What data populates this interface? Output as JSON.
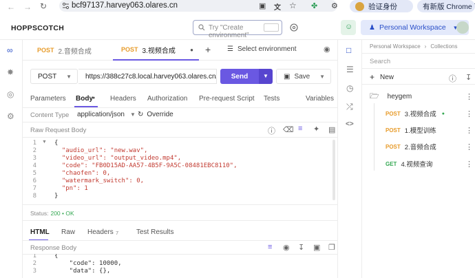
{
  "browser": {
    "url": "bcf97137.harvey063.olares.cn",
    "profile_label": "验证身份",
    "update_label": "有新版 Chrome 可用"
  },
  "header": {
    "brand": "HOPPSCOTCH",
    "search_placeholder": "Try \"Create environment\"",
    "workspace_label": "Personal Workspace"
  },
  "tabs": [
    {
      "method": "POST",
      "label": "2.音频合成"
    },
    {
      "method": "POST",
      "label": "3.视频合成"
    }
  ],
  "env_select": "Select environment",
  "request": {
    "method": "POST",
    "url": "https://388c27c8.local.harvey063.olares.cn/easy",
    "send_label": "Send",
    "save_label": "Save"
  },
  "request_tabs": [
    "Parameters",
    "Body",
    "Headers",
    "Authorization",
    "Pre-request Script",
    "Tests",
    "Variables"
  ],
  "content_type_label": "Content Type",
  "content_type_value": "application/json",
  "override_label": "Override",
  "raw_body_label": "Raw Request Body",
  "body_lines": [
    {
      "n": "1",
      "t": "{"
    },
    {
      "n": "2",
      "t": "  \"audio_url\": \"new.wav\","
    },
    {
      "n": "3",
      "t": "  \"video_url\": \"output_video.mp4\","
    },
    {
      "n": "4",
      "t": "  \"code\": \"FB0D15AD-AA57-4B5F-9A5C-08481EBC8110\","
    },
    {
      "n": "5",
      "t": "  \"chaofen\": 0,"
    },
    {
      "n": "6",
      "t": "  \"watermark_switch\": 0,"
    },
    {
      "n": "7",
      "t": "  \"pn\": 1"
    },
    {
      "n": "8",
      "t": "}"
    }
  ],
  "status_label": "Status:",
  "status_value": "200 • OK",
  "response_tabs": [
    "HTML",
    "Raw",
    "Headers",
    "Test Results"
  ],
  "response_headers_count": "7",
  "response_body_label": "Response Body",
  "response_lines": [
    {
      "n": "1",
      "t": "{"
    },
    {
      "n": "2",
      "t": "    \"code\": 10000,"
    },
    {
      "n": "3",
      "t": "    \"data\": {},"
    }
  ],
  "sidebar": {
    "breadcrumb_1": "Personal Workspace",
    "breadcrumb_2": "Collections",
    "search_placeholder": "Search",
    "new_label": "New",
    "collection_name": "heygem",
    "requests": [
      {
        "method": "POST",
        "label": "3.视频合成"
      },
      {
        "method": "POST",
        "label": "1.模型训练"
      },
      {
        "method": "POST",
        "label": "2.音频合成"
      },
      {
        "method": "GET",
        "label": "4.视频查询"
      }
    ]
  },
  "colors": {
    "accent": "#6a58e2",
    "post": "#e79b2a",
    "get": "#35a853"
  }
}
